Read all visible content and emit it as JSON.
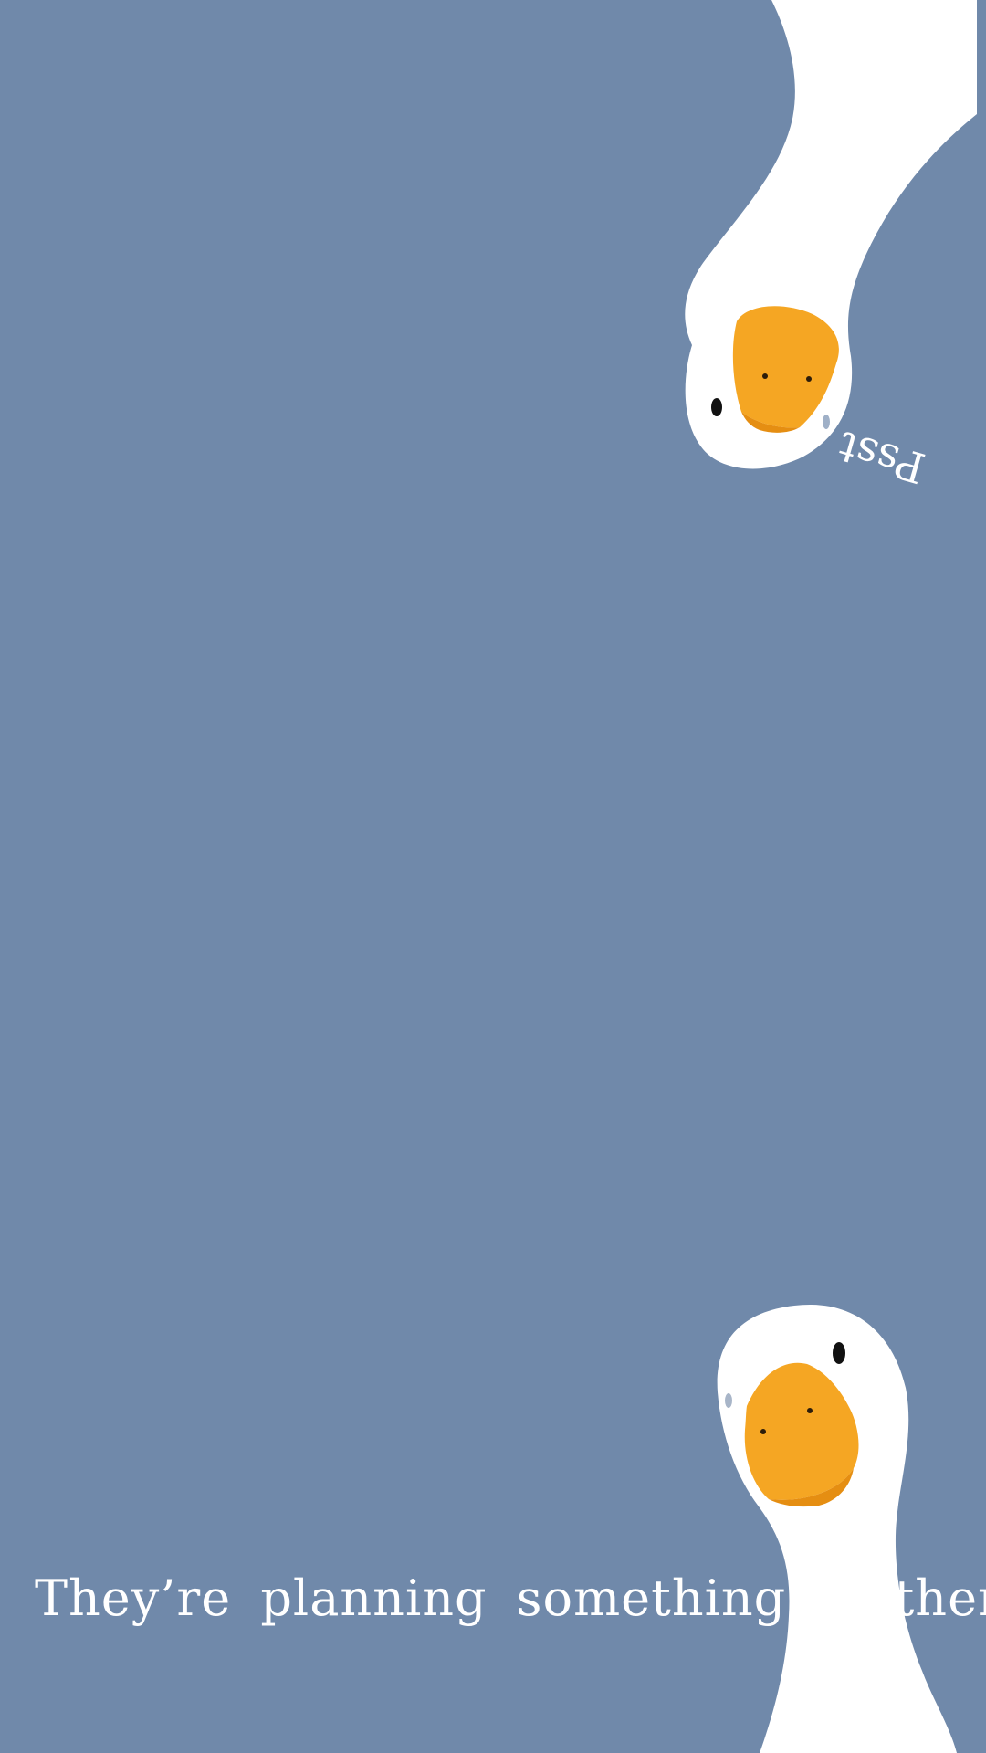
{
  "background_color": "#7089aa",
  "top_bubble_text": "Psst",
  "caption_text": "They’re planning something in there",
  "goose_colors": {
    "body": "#ffffff",
    "beak": "#f5a623",
    "beak_shadow": "#e58e12",
    "eye": "#111111"
  },
  "icons": {
    "top_goose": "upside-down-goose-icon",
    "bottom_goose": "peeking-goose-icon"
  }
}
